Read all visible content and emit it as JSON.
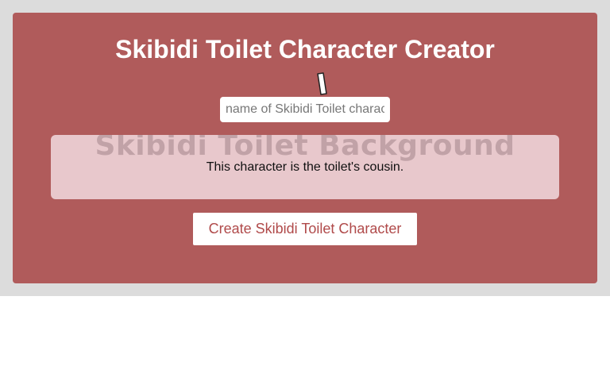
{
  "app": {
    "title": "Skibidi Toilet Character Creator"
  },
  "name_input": {
    "placeholder": "name of Skibidi Toilet character",
    "value": ""
  },
  "background_panel": {
    "watermark": "Skibidi Toilet Background",
    "description": "This character is the toilet's cousin."
  },
  "create_button": {
    "label": "Create Skibidi Toilet Character"
  },
  "cursor": {
    "icon": "text-cursor-icon"
  },
  "colors": {
    "card_background": "#b05b5b",
    "page_band": "#dcdcdc",
    "panel_background": "#e8c8cc",
    "button_text": "#b04a4a"
  }
}
